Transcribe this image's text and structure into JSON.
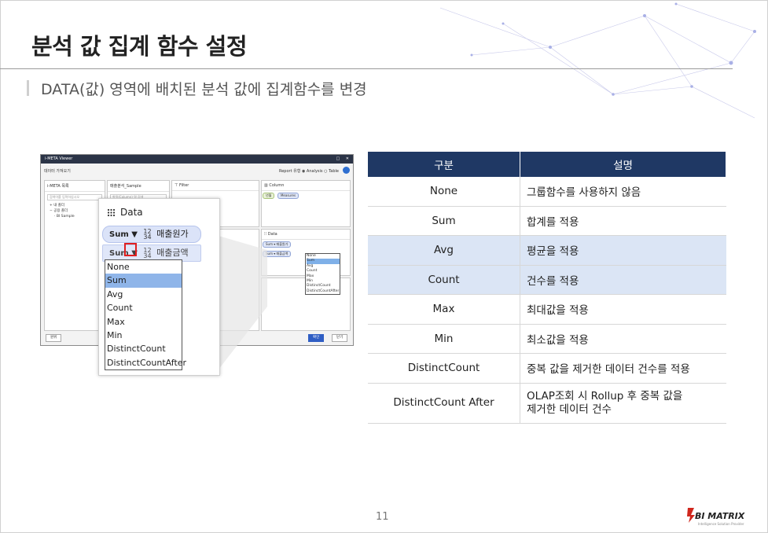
{
  "page": {
    "title": "분석 값 집계 함수 설정",
    "subtitle": "DATA(값) 영역에 배치된 분석 값에 집계함수를 변경",
    "page_number": "11"
  },
  "logo": {
    "brand": "BI MATRIX",
    "tagline": "Intelligence Solution Provider",
    "accent_color": "#d0271d"
  },
  "viewer": {
    "window_title": "i-META Viewer",
    "minimize_icon": "□",
    "close_icon": "✕",
    "header": "데이터 가져오기",
    "report_type_label": "Report 유형",
    "report_options": [
      "Analysis",
      "Table"
    ],
    "meta_list_title": "i-META 목록",
    "meta_search_placeholder": "검색어를 입력하십시오",
    "tree_items": [
      "내 폴더",
      "공용 폴더",
      "BI Sample"
    ],
    "columns_title": "매출분석_Sample",
    "columns_search_placeholder": "항목(Column) 명 검색",
    "filter_title": "Filter",
    "column_title": "Column",
    "column_chips": [
      "년월",
      "Measures"
    ],
    "data_title": "Data",
    "data_chips": [
      "매출원가",
      "매출금액"
    ],
    "mini_agg_options": [
      "None",
      "Sum",
      "Avg",
      "Count",
      "Max",
      "Min",
      "DistinctCount",
      "DistinctCountAfter"
    ],
    "reset_button": "원위",
    "ok_button": "확인",
    "close_button": "닫기"
  },
  "zoom": {
    "title": "Data",
    "items": [
      {
        "agg": "Sum ▼",
        "num_top": "12",
        "num_bottom": "34",
        "label": "매출원가"
      },
      {
        "agg": "Sum ▼",
        "num_top": "12",
        "num_bottom": "34",
        "label": "매출금액"
      }
    ],
    "options": [
      "None",
      "Sum",
      "Avg",
      "Count",
      "Max",
      "Min",
      "DistinctCount",
      "DistinctCountAfter"
    ],
    "selected_option": "Sum"
  },
  "table": {
    "headers": [
      "구분",
      "설명"
    ],
    "rows": [
      {
        "name": "None",
        "desc": "그룹함수를 사용하지 않음"
      },
      {
        "name": "Sum",
        "desc": "합계를 적용"
      },
      {
        "name": "Avg",
        "desc": "평균을 적용"
      },
      {
        "name": "Count",
        "desc": "건수를 적용"
      },
      {
        "name": "Max",
        "desc": "최대값을 적용"
      },
      {
        "name": "Min",
        "desc": "최소값을 적용"
      },
      {
        "name": "DistinctCount",
        "desc": "중복 값을 제거한 데이터 건수를 적용"
      },
      {
        "name": "DistinctCount After",
        "desc": "OLAP조회 시 Rollup 후 중복 값을",
        "desc2": "제거한 데이터 건수"
      }
    ],
    "header_color": "#1f3864",
    "highlight_color": "#dbe5f5"
  }
}
